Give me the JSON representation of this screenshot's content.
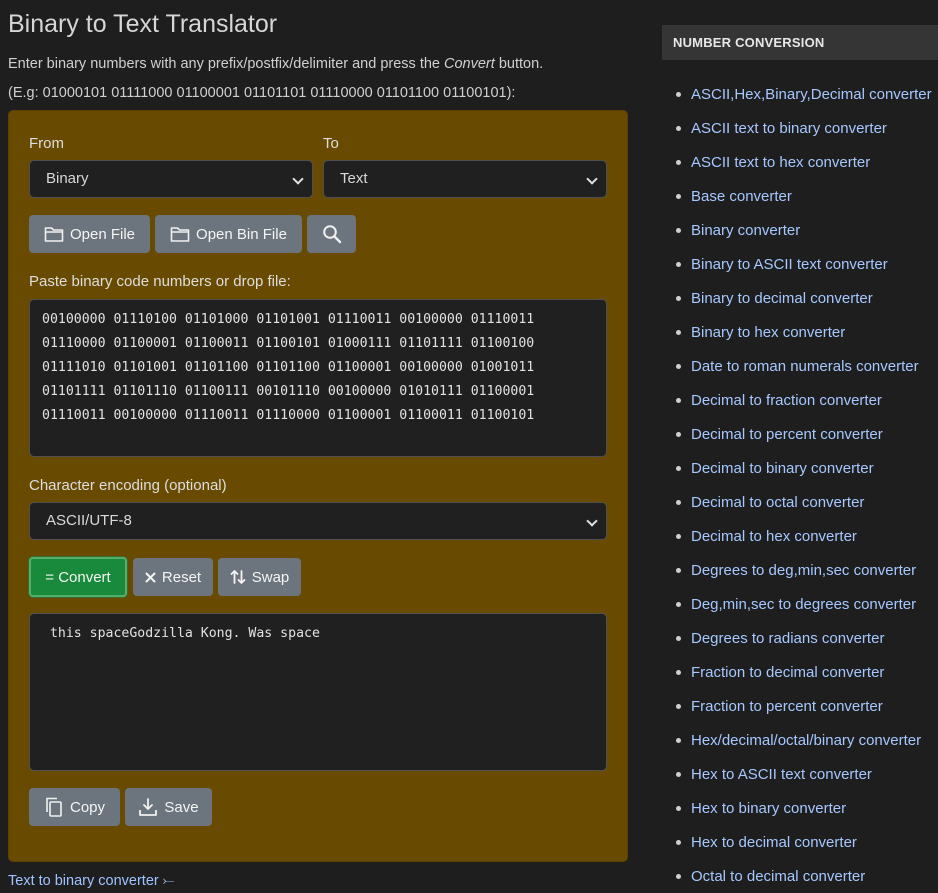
{
  "page": {
    "title": "Binary to Text Translator",
    "intro_before": "Enter binary numbers with any prefix/postfix/delimiter and press the ",
    "intro_em": "Convert",
    "intro_after": " button.",
    "example": "(E.g: 01000101 01111000 01100001 01101101 01110000 01101100 01100101):"
  },
  "form": {
    "from_label": "From",
    "from_value": "Binary",
    "to_label": "To",
    "to_value": "Text",
    "open_file": "Open File",
    "open_bin_file": "Open Bin File",
    "input_label": "Paste binary code numbers or drop file:",
    "input_value": "00100000 01110100 01101000 01101001 01110011 00100000 01110011\n01110000 01100001 01100011 01100101 01000111 01101111 01100100\n01111010 01101001 01101100 01101100 01100001 00100000 01001011\n01101111 01101110 01100111 00101110 00100000 01010111 01100001\n01110011 00100000 01110011 01110000 01100001 01100011 01100101",
    "encoding_label": "Character encoding (optional)",
    "encoding_value": "ASCII/UTF-8",
    "convert": "= Convert",
    "reset": "Reset",
    "swap": "Swap",
    "output_value": " this spaceGodzilla Kong. Was space",
    "copy": "Copy",
    "save": "Save"
  },
  "bottom_link": "Text to binary converter ⤚",
  "sidebar": {
    "heading": "NUMBER CONVERSION",
    "items": [
      "ASCII,Hex,Binary,Decimal converter",
      "ASCII text to binary converter",
      "ASCII text to hex converter",
      "Base converter",
      "Binary converter",
      "Binary to ASCII text converter",
      "Binary to decimal converter",
      "Binary to hex converter",
      "Date to roman numerals converter",
      "Decimal to fraction converter",
      "Decimal to percent converter",
      "Decimal to binary converter",
      "Decimal to octal converter",
      "Decimal to hex converter",
      "Degrees to deg,min,sec converter",
      "Deg,min,sec to degrees converter",
      "Degrees to radians converter",
      "Fraction to decimal converter",
      "Fraction to percent converter",
      "Hex/decimal/octal/binary converter",
      "Hex to ASCII text converter",
      "Hex to binary converter",
      "Hex to decimal converter",
      "Octal to decimal converter"
    ]
  },
  "colors": {
    "panel": "#684b00",
    "link": "#a6c8ff",
    "convert_button": "#198a3c",
    "secondary_button": "#6c757d"
  }
}
